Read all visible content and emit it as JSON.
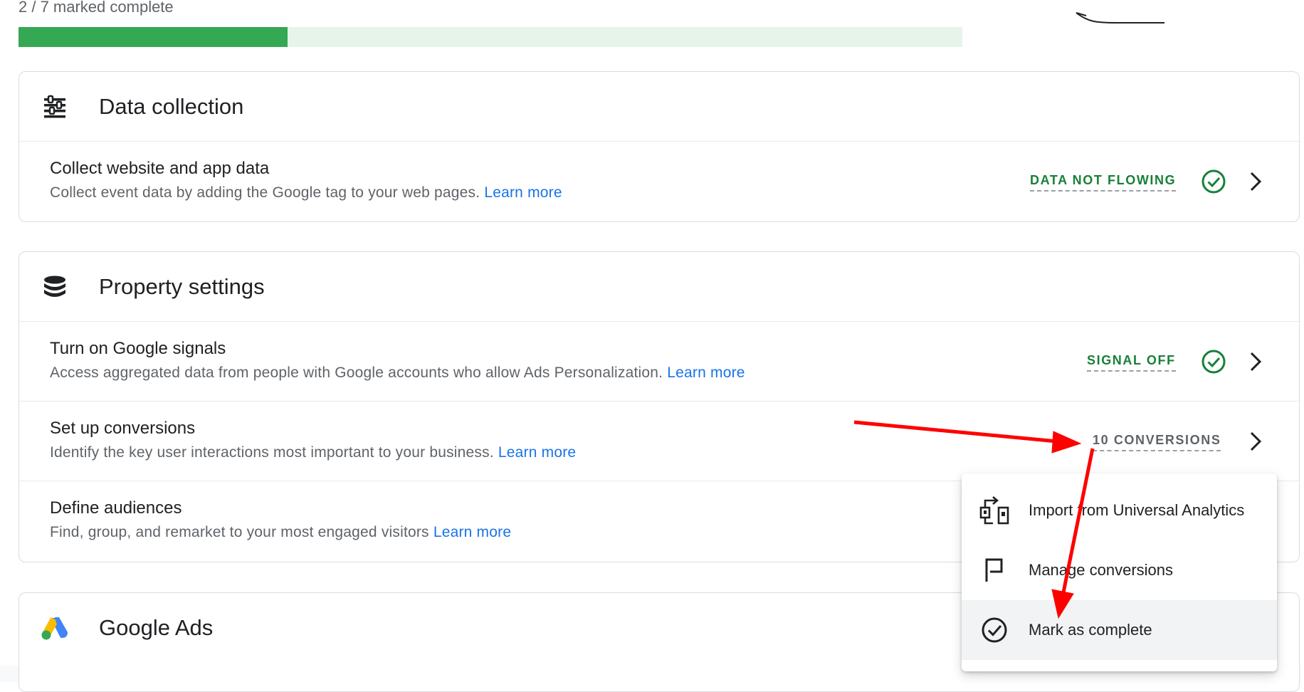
{
  "progress": {
    "label": "2 / 7 marked complete",
    "fraction": 0.285
  },
  "data_collection": {
    "title": "Data collection",
    "icon": "tune-lines-icon",
    "rows": [
      {
        "title": "Collect website and app data",
        "desc": "Collect event data by adding the Google tag to your web pages.",
        "link": "Learn more",
        "status": "DATA NOT FLOWING",
        "status_color": "#188038"
      }
    ]
  },
  "property_settings": {
    "title": "Property settings",
    "icon": "database-icon",
    "rows": [
      {
        "title": "Turn on Google signals",
        "desc": "Access aggregated data from people with Google accounts who allow Ads Personalization.",
        "link": "Learn more",
        "status": "SIGNAL OFF",
        "status_color": "#188038"
      },
      {
        "title": "Set up conversions",
        "desc": "Identify the key user interactions most important to your business.",
        "link": "Learn more",
        "status": "10 CONVERSIONS",
        "status_color": "#5f6368"
      },
      {
        "title": "Define audiences",
        "desc": "Find, group, and remarket to your most engaged visitors",
        "link": "Learn more"
      }
    ]
  },
  "google_ads": {
    "title": "Google Ads",
    "icon": "google-ads-logo-icon"
  },
  "menu": {
    "items": [
      {
        "label": "Import from Universal Analytics",
        "icon": "import-icon"
      },
      {
        "label": "Manage conversions",
        "icon": "flag-icon"
      },
      {
        "label": "Mark as complete",
        "icon": "check-circle-icon"
      }
    ]
  },
  "colors": {
    "green": "#34a853",
    "link": "#1a73e8",
    "annotation": "#ff0000"
  }
}
